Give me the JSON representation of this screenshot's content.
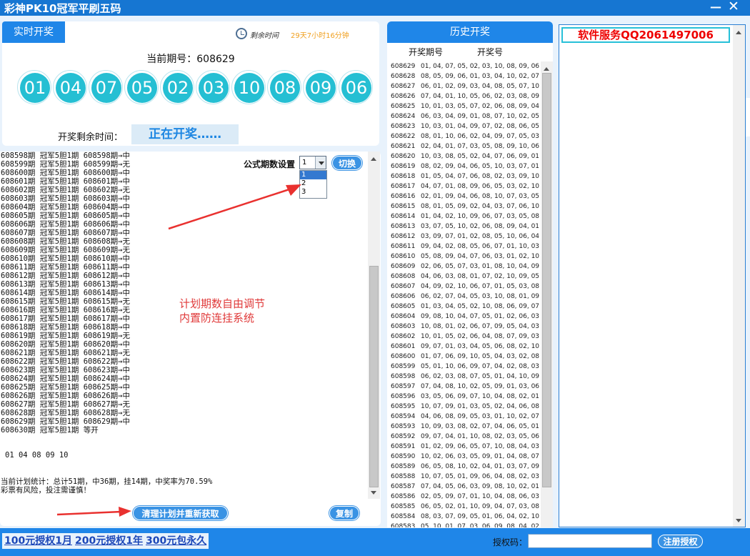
{
  "window": {
    "title": "彩神PK10冠军平刷五码",
    "minimize_glyph": "—",
    "close_glyph": "✕"
  },
  "live": {
    "tab": "实时开奖",
    "remaining_label": "剩余时间",
    "remaining_value": "29天7小时16分钟",
    "current_period": "当前期号：608629",
    "balls": [
      "01",
      "04",
      "07",
      "05",
      "02",
      "03",
      "10",
      "08",
      "09",
      "06"
    ],
    "open_label": "开奖剩余时间：",
    "open_status": "正在开奖……"
  },
  "log": {
    "lines": [
      "608598期 冠军5胆1期 608598期→中",
      "608599期 冠军5胆1期 608599期→无",
      "608600期 冠军5胆1期 608600期→中",
      "608601期 冠军5胆1期 608601期→中",
      "608602期 冠军5胆1期 608602期→无",
      "608603期 冠军5胆1期 608603期→中",
      "608604期 冠军5胆1期 608604期→中",
      "608605期 冠军5胆1期 608605期→中",
      "608606期 冠军5胆1期 608606期→中",
      "608607期 冠军5胆1期 608607期→中",
      "608608期 冠军5胆1期 608608期→无",
      "608609期 冠军5胆1期 608609期→无",
      "608610期 冠军5胆1期 608610期→中",
      "608611期 冠军5胆1期 608611期→中",
      "608612期 冠军5胆1期 608612期→中",
      "608613期 冠军5胆1期 608613期→中",
      "608614期 冠军5胆1期 608614期→中",
      "608615期 冠军5胆1期 608615期→无",
      "608616期 冠军5胆1期 608616期→无",
      "608617期 冠军5胆1期 608617期→中",
      "608618期 冠军5胆1期 608618期→中",
      "608619期 冠军5胆1期 608619期→无",
      "608620期 冠军5胆1期 608620期→中",
      "608621期 冠军5胆1期 608621期→无",
      "608622期 冠军5胆1期 608622期→中",
      "608623期 冠军5胆1期 608623期→中",
      "608624期 冠军5胆1期 608624期→中",
      "608625期 冠军5胆1期 608625期→中",
      "608626期 冠军5胆1期 608626期→中",
      "608627期 冠军5胆1期 608627期→无",
      "608628期 冠军5胆1期 608628期→无",
      "608629期 冠军5胆1期 608629期→中",
      "608630期 冠军5胆1期 等开"
    ],
    "setting_label": "公式期数设置",
    "selected": "1",
    "options": [
      "1",
      "2",
      "3"
    ],
    "switch_btn": "切换",
    "annotation": "计划期数自由调节\n内置防连挂系统",
    "numbers": "01 04 08 09 10",
    "stats": "当前计划统计：总计51期，中36期，挂14期，中奖率为70.59%\n彩票有风险，投注需谨慎！",
    "clear_btn": "清理计划并重新获取",
    "copy_btn": "复制"
  },
  "history": {
    "title": "历史开奖",
    "col_period": "开奖期号",
    "col_numbers": "开奖号",
    "rows": [
      [
        "608629",
        "01, 04, 07, 05, 02, 03, 10, 08, 09, 06"
      ],
      [
        "608628",
        "08, 05, 09, 06, 01, 03, 04, 10, 02, 07"
      ],
      [
        "608627",
        "06, 01, 02, 09, 03, 04, 08, 05, 07, 10"
      ],
      [
        "608626",
        "07, 04, 01, 10, 05, 06, 02, 03, 08, 09"
      ],
      [
        "608625",
        "10, 01, 03, 05, 07, 02, 06, 08, 09, 04"
      ],
      [
        "608624",
        "06, 03, 04, 09, 01, 08, 07, 10, 02, 05"
      ],
      [
        "608623",
        "10, 03, 01, 04, 09, 07, 02, 08, 06, 05"
      ],
      [
        "608622",
        "08, 01, 10, 06, 02, 04, 09, 07, 05, 03"
      ],
      [
        "608621",
        "02, 04, 01, 07, 03, 05, 08, 09, 10, 06"
      ],
      [
        "608620",
        "10, 03, 08, 05, 02, 04, 07, 06, 09, 01"
      ],
      [
        "608619",
        "08, 02, 09, 04, 06, 05, 10, 03, 07, 01"
      ],
      [
        "608618",
        "01, 05, 04, 07, 06, 08, 02, 03, 09, 10"
      ],
      [
        "608617",
        "04, 07, 01, 08, 09, 06, 05, 03, 02, 10"
      ],
      [
        "608616",
        "02, 01, 09, 04, 06, 08, 10, 07, 03, 05"
      ],
      [
        "608615",
        "08, 01, 05, 09, 02, 04, 03, 07, 06, 10"
      ],
      [
        "608614",
        "01, 04, 02, 10, 09, 06, 07, 03, 05, 08"
      ],
      [
        "608613",
        "03, 07, 05, 10, 02, 06, 08, 09, 04, 01"
      ],
      [
        "608612",
        "03, 09, 07, 01, 02, 08, 05, 10, 06, 04"
      ],
      [
        "608611",
        "09, 04, 02, 08, 05, 06, 07, 01, 10, 03"
      ],
      [
        "608610",
        "05, 08, 09, 04, 07, 06, 03, 01, 02, 10"
      ],
      [
        "608609",
        "02, 06, 05, 07, 03, 01, 08, 10, 04, 09"
      ],
      [
        "608608",
        "04, 06, 03, 08, 01, 07, 02, 10, 09, 05"
      ],
      [
        "608607",
        "04, 09, 02, 10, 06, 07, 01, 05, 03, 08"
      ],
      [
        "608606",
        "06, 02, 07, 04, 05, 03, 10, 08, 01, 09"
      ],
      [
        "608605",
        "01, 03, 04, 05, 02, 10, 08, 06, 09, 07"
      ],
      [
        "608604",
        "09, 08, 10, 04, 07, 05, 01, 02, 06, 03"
      ],
      [
        "608603",
        "10, 08, 01, 02, 06, 07, 09, 05, 04, 03"
      ],
      [
        "608602",
        "10, 01, 05, 02, 06, 04, 08, 07, 09, 03"
      ],
      [
        "608601",
        "09, 07, 01, 03, 04, 05, 06, 08, 02, 10"
      ],
      [
        "608600",
        "01, 07, 06, 09, 10, 05, 04, 03, 02, 08"
      ],
      [
        "608599",
        "05, 01, 10, 06, 09, 07, 04, 02, 08, 03"
      ],
      [
        "608598",
        "06, 02, 03, 08, 07, 05, 01, 04, 10, 09"
      ],
      [
        "608597",
        "07, 04, 08, 10, 02, 05, 09, 01, 03, 06"
      ],
      [
        "608596",
        "03, 05, 06, 09, 07, 10, 04, 08, 02, 01"
      ],
      [
        "608595",
        "10, 07, 09, 01, 03, 05, 02, 04, 06, 08"
      ],
      [
        "608594",
        "04, 06, 08, 09, 05, 03, 01, 10, 02, 07"
      ],
      [
        "608593",
        "10, 09, 03, 08, 02, 07, 04, 06, 05, 01"
      ],
      [
        "608592",
        "09, 07, 04, 01, 10, 08, 02, 03, 05, 06"
      ],
      [
        "608591",
        "01, 02, 09, 06, 05, 07, 10, 08, 04, 03"
      ],
      [
        "608590",
        "10, 02, 06, 03, 05, 09, 01, 04, 08, 07"
      ],
      [
        "608589",
        "06, 05, 08, 10, 02, 04, 01, 03, 07, 09"
      ],
      [
        "608588",
        "10, 07, 05, 01, 09, 06, 04, 08, 02, 03"
      ],
      [
        "608587",
        "07, 04, 05, 06, 03, 09, 08, 10, 02, 01"
      ],
      [
        "608586",
        "02, 05, 09, 07, 01, 10, 04, 08, 06, 03"
      ],
      [
        "608585",
        "06, 05, 02, 01, 10, 09, 04, 07, 03, 08"
      ],
      [
        "608584",
        "08, 03, 07, 09, 05, 01, 06, 04, 02, 10"
      ],
      [
        "608583",
        "05, 10, 01, 07, 03, 06, 09, 08, 04, 02"
      ]
    ]
  },
  "service": {
    "title": "软件服务QQ2061497006"
  },
  "footer": {
    "links": [
      "100元授权1月",
      "200元授权1年",
      "300元包永久"
    ],
    "auth_label": "授权码：",
    "register_btn": "注册授权"
  }
}
